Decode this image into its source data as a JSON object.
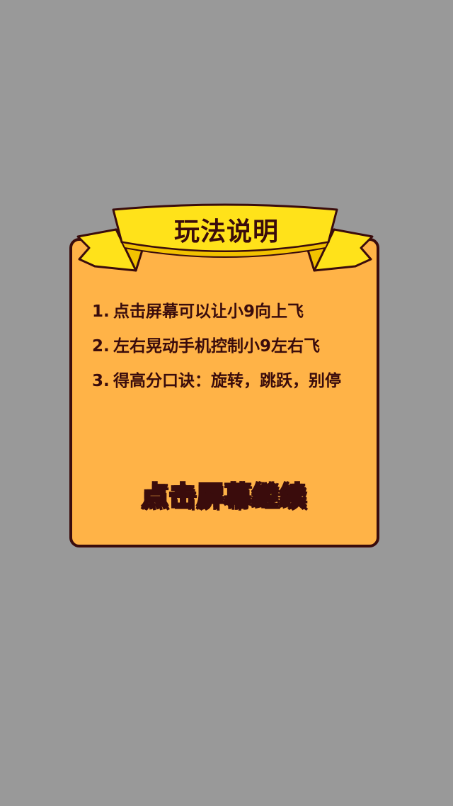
{
  "dialog": {
    "title": "玩法说明",
    "rules": [
      {
        "number": "1.",
        "text": "点击屏幕可以让小9向上飞"
      },
      {
        "number": "2.",
        "text": "左右晃动手机控制小9左右飞"
      },
      {
        "number": "3.",
        "text": "得高分口诀：旋转，跳跃，别停"
      }
    ],
    "continue_label": "点击屏幕继续"
  },
  "colors": {
    "background": "#999999",
    "panel": "#FFB347",
    "outline": "#3a0c0c",
    "ribbon": "#FFE21A",
    "ribbon_shade": "#F2C200"
  }
}
